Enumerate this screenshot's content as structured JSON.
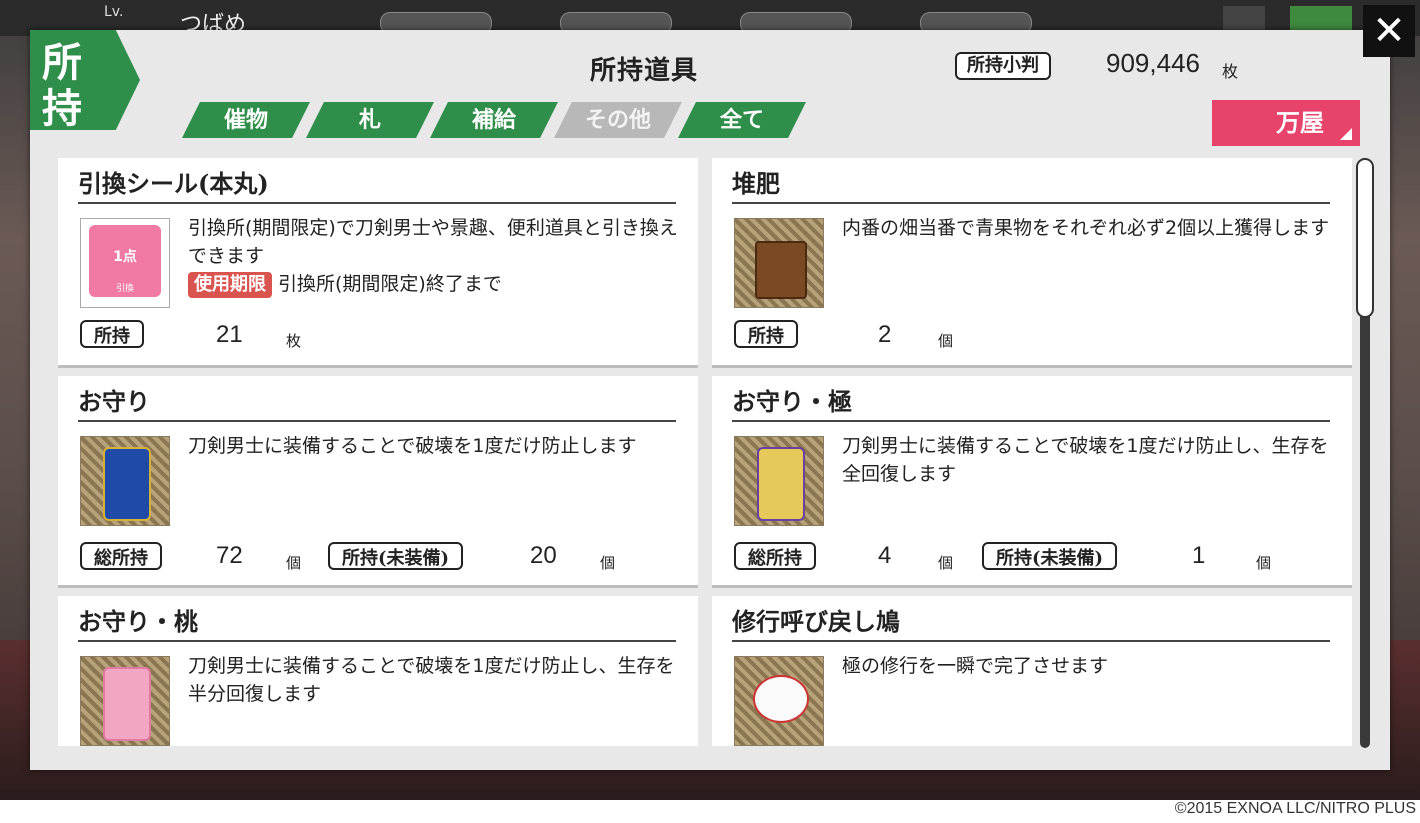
{
  "background": {
    "player_level_label": "Lv.",
    "player_name": "つばめ"
  },
  "close_glyph": "✕",
  "category_badge": {
    "line1": "所",
    "line2": "持"
  },
  "title": "所持道具",
  "koban": {
    "label": "所持小判",
    "value": "909,446",
    "unit": "枚"
  },
  "tabs": [
    {
      "label": "催物",
      "active": true
    },
    {
      "label": "札",
      "active": true
    },
    {
      "label": "補給",
      "active": true
    },
    {
      "label": "その他",
      "active": false
    },
    {
      "label": "全て",
      "active": true
    }
  ],
  "shop_button": "万屋",
  "items": [
    {
      "name": "引換シール(本丸)",
      "description": "引換所(期間限定)で刀剣男士や景趣、便利道具と引き換えできます",
      "expiry_tag": "使用期限",
      "expiry_text": "引換所(期間限定)終了まで",
      "icon": "exchange-sticker-icon",
      "icon_text": "1点",
      "icon_subtext": "引換",
      "owned_label": "所持",
      "owned_count": "21",
      "owned_unit": "枚"
    },
    {
      "name": "堆肥",
      "description": "内番の畑当番で青果物をそれぞれ必ず2個以上獲得します",
      "icon": "compost-bucket-icon",
      "owned_label": "所持",
      "owned_count": "2",
      "owned_unit": "個"
    },
    {
      "name": "お守り",
      "description": "刀剣男士に装備することで破壊を1度だけ防止します",
      "icon": "omamori-blue-icon",
      "total_label": "総所持",
      "total_count": "72",
      "total_unit": "個",
      "unequipped_label": "所持(未装備)",
      "unequipped_count": "20",
      "unequipped_unit": "個"
    },
    {
      "name": "お守り・極",
      "description": "刀剣男士に装備することで破壊を1度だけ防止し、生存を全回復します",
      "icon": "omamori-gold-icon",
      "total_label": "総所持",
      "total_count": "4",
      "total_unit": "個",
      "unequipped_label": "所持(未装備)",
      "unequipped_count": "1",
      "unequipped_unit": "個"
    },
    {
      "name": "お守り・桃",
      "description": "刀剣男士に装備することで破壊を1度だけ防止し、生存を半分回復します",
      "icon": "omamori-pink-icon"
    },
    {
      "name": "修行呼び戻し鳩",
      "description": "極の修行を一瞬で完了させます",
      "icon": "recall-pigeon-icon"
    }
  ],
  "colors": {
    "accent_green": "#2f8f4a",
    "shop_pink": "#e8436b",
    "tag_red": "#d9534f",
    "inactive_tab": "#b8b8b8"
  },
  "copyright": "©2015 EXNOA LLC/NITRO PLUS"
}
